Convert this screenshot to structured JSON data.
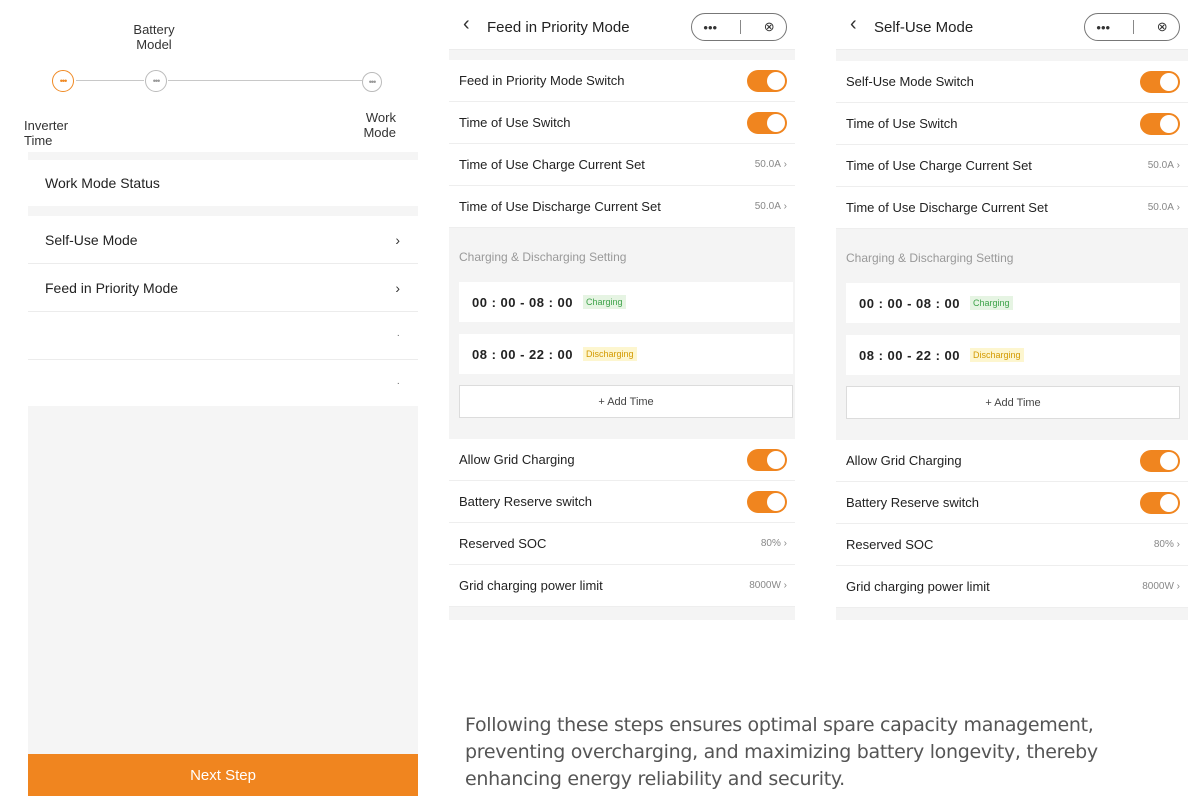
{
  "stepper": {
    "steps": [
      {
        "label": "Inverter\nTime",
        "state": "active"
      },
      {
        "label": "Battery\nModel",
        "state": "pending"
      },
      {
        "label": "Work\nMode",
        "state": "pending"
      }
    ]
  },
  "left_menu": {
    "section_title": "Work Mode Status",
    "items": [
      {
        "label": "Self-Use Mode",
        "chevron": "›"
      },
      {
        "label": "Feed in Priority Mode",
        "chevron": "›"
      },
      {
        "label": "",
        "chevron": "·"
      },
      {
        "label": "",
        "chevron": "·"
      }
    ],
    "next_button": "Next Step"
  },
  "capsule": {
    "more_icon": "more-dots-icon",
    "close_icon": "close-circle-icon"
  },
  "panels": [
    {
      "title": "Feed in Priority Mode",
      "rows_top": [
        {
          "label": "Feed in Priority Mode Switch",
          "kind": "toggle",
          "on": true
        },
        {
          "label": "Time of Use Switch",
          "kind": "toggle",
          "on": true
        },
        {
          "label": "Time of Use Charge Current Set",
          "kind": "value",
          "value": "50.0A"
        },
        {
          "label": "Time of Use Discharge Current Set",
          "kind": "value",
          "value": "50.0A"
        }
      ],
      "section_title": "Charging & Discharging Setting",
      "slots": [
        {
          "time": "00 : 00 - 08 : 00",
          "badge": "Charging",
          "type": "chg"
        },
        {
          "time": "08 : 00 - 22 : 00",
          "badge": "Discharging",
          "type": "dis"
        }
      ],
      "add_time": "+ Add Time",
      "rows_bottom": [
        {
          "label": "Allow Grid Charging",
          "kind": "toggle",
          "on": true
        },
        {
          "label": "Battery Reserve switch",
          "kind": "toggle",
          "on": true
        },
        {
          "label": "Reserved SOC",
          "kind": "value",
          "value": "80%"
        },
        {
          "label": "Grid charging power limit",
          "kind": "value",
          "value": "8000W"
        }
      ]
    },
    {
      "title": "Self-Use Mode",
      "rows_top": [
        {
          "label": "Self-Use Mode Switch",
          "kind": "toggle",
          "on": true
        },
        {
          "label": "Time of Use Switch",
          "kind": "toggle",
          "on": true
        },
        {
          "label": "Time of Use Charge Current Set",
          "kind": "value",
          "value": "50.0A"
        },
        {
          "label": "Time of Use Discharge Current Set",
          "kind": "value",
          "value": "50.0A"
        }
      ],
      "section_title": "Charging & Discharging Setting",
      "slots": [
        {
          "time": "00 : 00 - 08 : 00",
          "badge": "Charging",
          "type": "chg"
        },
        {
          "time": "08 : 00 - 22 : 00",
          "badge": "Discharging",
          "type": "dis"
        }
      ],
      "add_time": "+ Add Time",
      "rows_bottom": [
        {
          "label": "Allow Grid Charging",
          "kind": "toggle",
          "on": true
        },
        {
          "label": "Battery Reserve switch",
          "kind": "toggle",
          "on": true
        },
        {
          "label": "Reserved SOC",
          "kind": "value",
          "value": "80%"
        },
        {
          "label": "Grid charging power limit",
          "kind": "value",
          "value": "8000W"
        }
      ]
    }
  ],
  "paragraph": "Following these steps ensures optimal spare capacity management, preventing overcharging, and maximizing battery longevity, thereby enhancing energy reliability and security.",
  "colors": {
    "accent": "#f0851f",
    "charging": "#3ea34a",
    "discharging": "#d39a00"
  }
}
